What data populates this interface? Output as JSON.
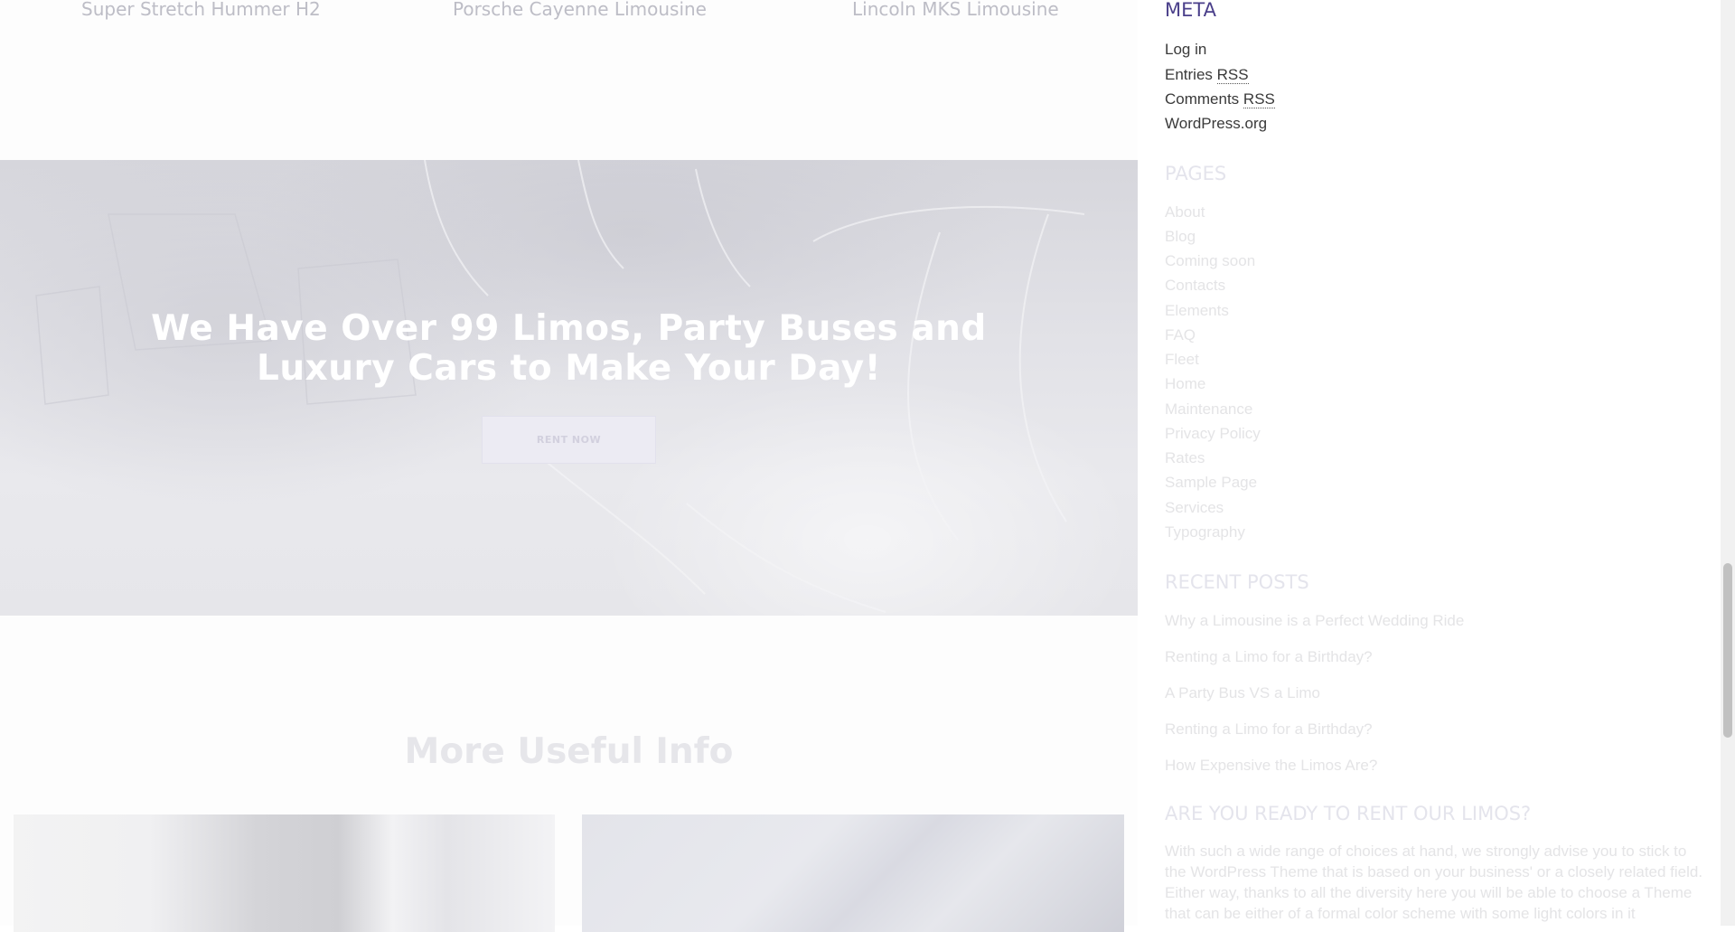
{
  "fleet": {
    "titles": [
      "Super Stretch Hummer H2",
      "Porsche Cayenne Limousine",
      "Lincoln MKS Limousine"
    ]
  },
  "banner": {
    "heading_line1": "We Have Over 99 Limos, Party Buses and",
    "heading_line2": "Luxury Cars to Make Your Day!",
    "button_label": "RENT NOW"
  },
  "more_info": {
    "heading": "More Useful Info"
  },
  "sidebar": {
    "meta": {
      "title": "META",
      "log_in": "Log in",
      "entries_prefix": "Entries ",
      "entries_abbr": "RSS",
      "comments_prefix": "Comments ",
      "comments_abbr": "RSS",
      "wordpress": "WordPress.org"
    },
    "pages": {
      "title": "PAGES",
      "items": [
        "About",
        "Blog",
        "Coming soon",
        "Contacts",
        "Elements",
        "FAQ",
        "Fleet",
        "Home",
        "Maintenance",
        "Privacy Policy",
        "Rates",
        "Sample Page",
        "Services",
        "Typography"
      ]
    },
    "recent_posts": {
      "title": "RECENT POSTS",
      "items": [
        "Why a Limousine is a Perfect Wedding Ride",
        "Renting a Limo for a Birthday?",
        "A Party Bus VS a Limo",
        "Renting a Limo for a Birthday?",
        "How Expensive the Limos Are?"
      ]
    },
    "ready": {
      "title": "ARE YOU READY TO RENT OUR LIMOS?",
      "text": "With such a wide range of choices at hand, we strongly advise you to stick to the WordPress Theme that is based on your business' or a closely related field. Either way, thanks to all the diversity here you will be able to choose a Theme that can be either of a formal color scheme with some light colors in it"
    }
  },
  "colors": {
    "accent": "#4a3f8a",
    "banner_button": "#ecebf3"
  }
}
